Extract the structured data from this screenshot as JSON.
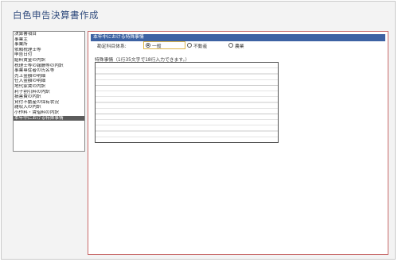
{
  "app": {
    "title": "白色申告決算書作成"
  },
  "sidebar": {
    "items": [
      {
        "label": "決算書項目"
      },
      {
        "label": "事業主"
      },
      {
        "label": "事業所"
      },
      {
        "label": "依頼税理士等"
      },
      {
        "label": "申告日付"
      },
      {
        "label": "給料賃金の内訳"
      },
      {
        "label": "税理士等の報酬等の内訳"
      },
      {
        "label": "事業専従者の氏名等"
      },
      {
        "label": "売上金額の明細"
      },
      {
        "label": "仕入金額の明細"
      },
      {
        "label": "地代家賃の内訳"
      },
      {
        "label": "利子割引料の内訳"
      },
      {
        "label": "損害費の内訳"
      },
      {
        "label": "貸付不動産の保有状況"
      },
      {
        "label": "雑収入の内訳"
      },
      {
        "label": "小作料・賃借料の内訳"
      },
      {
        "label": "本年中における特殊事情",
        "selected": true
      }
    ]
  },
  "main": {
    "header": "本年中における特殊事情",
    "category_label": "勘定科目体系:",
    "radios": [
      {
        "label": "一般",
        "selected": true
      },
      {
        "label": "不動産",
        "selected": false
      },
      {
        "label": "農業",
        "selected": false
      }
    ],
    "special_label": "特殊事情（1行35文字で18行入力できます。）"
  }
}
